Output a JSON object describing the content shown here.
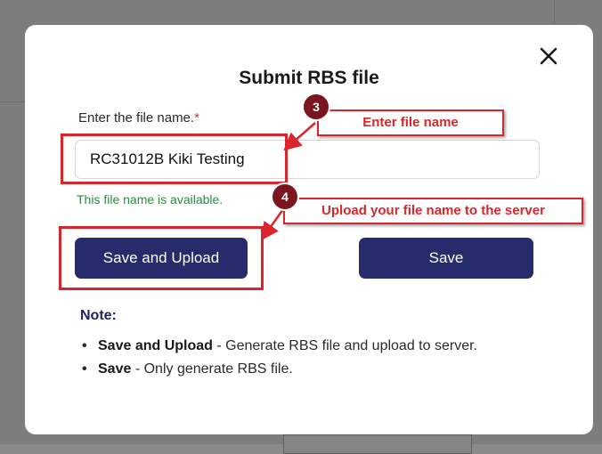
{
  "modal": {
    "title": "Submit RBS file",
    "close_icon": "close-icon",
    "file_label": "Enter the file name.",
    "required_mark": "*",
    "file_value": "RC31012B Kiki Testing",
    "availability": "This file name is available.",
    "save_upload_label": "Save and Upload",
    "save_label": "Save",
    "note_title": "Note:",
    "notes": [
      {
        "term": "Save and Upload",
        "desc": " - Generate RBS file and upload to server."
      },
      {
        "term": "Save",
        "desc": " - Only generate RBS file."
      }
    ]
  },
  "annotations": {
    "step3_number": "3",
    "step3_text": "Enter file name",
    "step4_number": "4",
    "step4_text": "Upload your file name to the server"
  },
  "colors": {
    "accent": "#262b6b",
    "annotation_red": "#d9262c",
    "available_green": "#2e8b3e"
  }
}
